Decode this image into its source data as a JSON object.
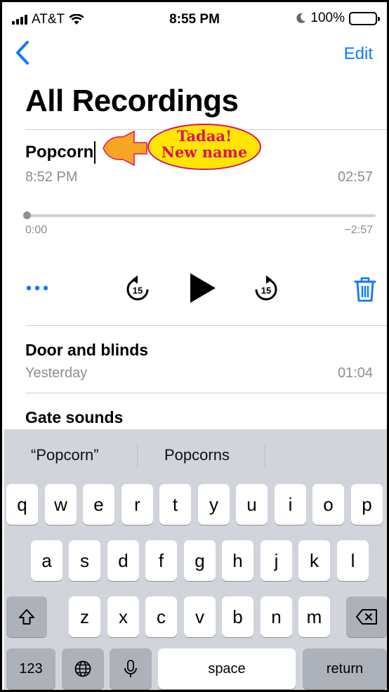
{
  "status_bar": {
    "carrier": "AT&T",
    "time": "8:55 PM",
    "battery": "100%"
  },
  "nav": {
    "back_icon": "chevron-left-icon",
    "edit_label": "Edit"
  },
  "page_title": "All Recordings",
  "recordings": [
    {
      "name": "Popcorn",
      "time": "8:52 PM",
      "duration": "02:57"
    },
    {
      "name": "Door and blinds",
      "time": "Yesterday",
      "duration": "01:04"
    },
    {
      "name": "Gate sounds"
    }
  ],
  "annotation": {
    "line1": "Tadaa!",
    "line2": "New name",
    "bubble_color": "#ffe600",
    "arrow_color": "#f5a623",
    "text_color": "#e0115f"
  },
  "player": {
    "elapsed": "0:00",
    "remaining": "−2:57",
    "progress": 0,
    "skip_back_seconds": "15",
    "skip_forward_seconds": "15",
    "icons": [
      "more-icon",
      "skip-back-15-icon",
      "play-icon",
      "skip-forward-15-icon",
      "trash-icon"
    ]
  },
  "keyboard": {
    "suggestions": [
      "“Popcorn”",
      "Popcorns"
    ],
    "row1": [
      "q",
      "w",
      "e",
      "r",
      "t",
      "y",
      "u",
      "i",
      "o",
      "p"
    ],
    "row2": [
      "a",
      "s",
      "d",
      "f",
      "g",
      "h",
      "j",
      "k",
      "l"
    ],
    "row3": [
      "z",
      "x",
      "c",
      "v",
      "b",
      "n",
      "m"
    ],
    "numbers_label": "123",
    "space_label": "space",
    "return_label": "return"
  },
  "colors": {
    "accent": "#0a7aff",
    "secondary_text": "#8e8e93"
  }
}
